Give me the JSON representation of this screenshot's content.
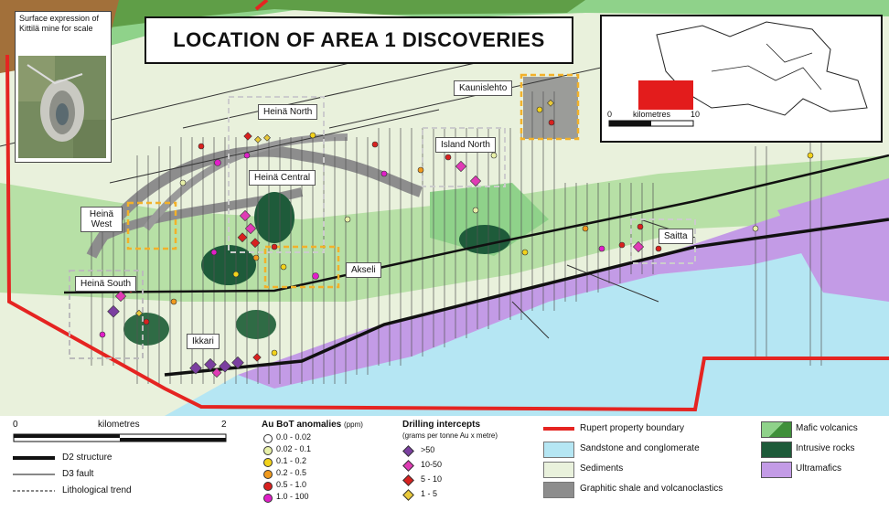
{
  "title": "LOCATION OF AREA 1 DISCOVERIES",
  "photo_caption": "Surface expression of Kittilä mine for scale",
  "place_labels": [
    "Heinä North",
    "Heinä Central",
    "Heinä West",
    "Heinä South",
    "Island North",
    "Kaunislehto",
    "Akseli",
    "Ikkari",
    "Saitta"
  ],
  "inset": {
    "scale_start": "0",
    "scale_end": "10",
    "scale_unit": "kilometres"
  },
  "scalebar": {
    "start": "0",
    "end": "2",
    "unit": "kilometres"
  },
  "structures": {
    "items": [
      "D2 structure",
      "D3 fault",
      "Lithological trend"
    ]
  },
  "bot": {
    "heading": "Au BoT anomalies",
    "unit": "(ppm)",
    "items": [
      "0.0 - 0.02",
      "0.02 - 0.1",
      "0.1 - 0.2",
      "0.2 - 0.5",
      "0.5 - 1.0",
      "1.0 - 100"
    ],
    "colors": [
      "#ffffff",
      "#e8f0a8",
      "#f2d21b",
      "#f09a1e",
      "#d8211f",
      "#e01fc8"
    ]
  },
  "drilling": {
    "heading": "Drilling intercepts",
    "subheading": "(grams per tonne Au x metre)",
    "items": [
      ">50",
      "10-50",
      "5 - 10",
      "1 - 5"
    ],
    "colors": [
      "#7b3fa0",
      "#e03bb5",
      "#d8211f",
      "#e9c93a"
    ]
  },
  "geology": {
    "boundary_label": "Rupert property boundary",
    "items": [
      "Sandstone and conglomerate",
      "Sediments",
      "Graphitic shale and volcanoclastics"
    ],
    "colors": [
      "#b5e6f3",
      "#e9f1dc",
      "#8d8d8d"
    ],
    "boundary_color": "#e52421"
  },
  "rocks": {
    "items": [
      "Mafic volcanics",
      "Intrusive rocks",
      "Ultramafics"
    ],
    "colors": [
      "#8fd28a",
      "#1e5b3a",
      "#c39be6"
    ]
  }
}
